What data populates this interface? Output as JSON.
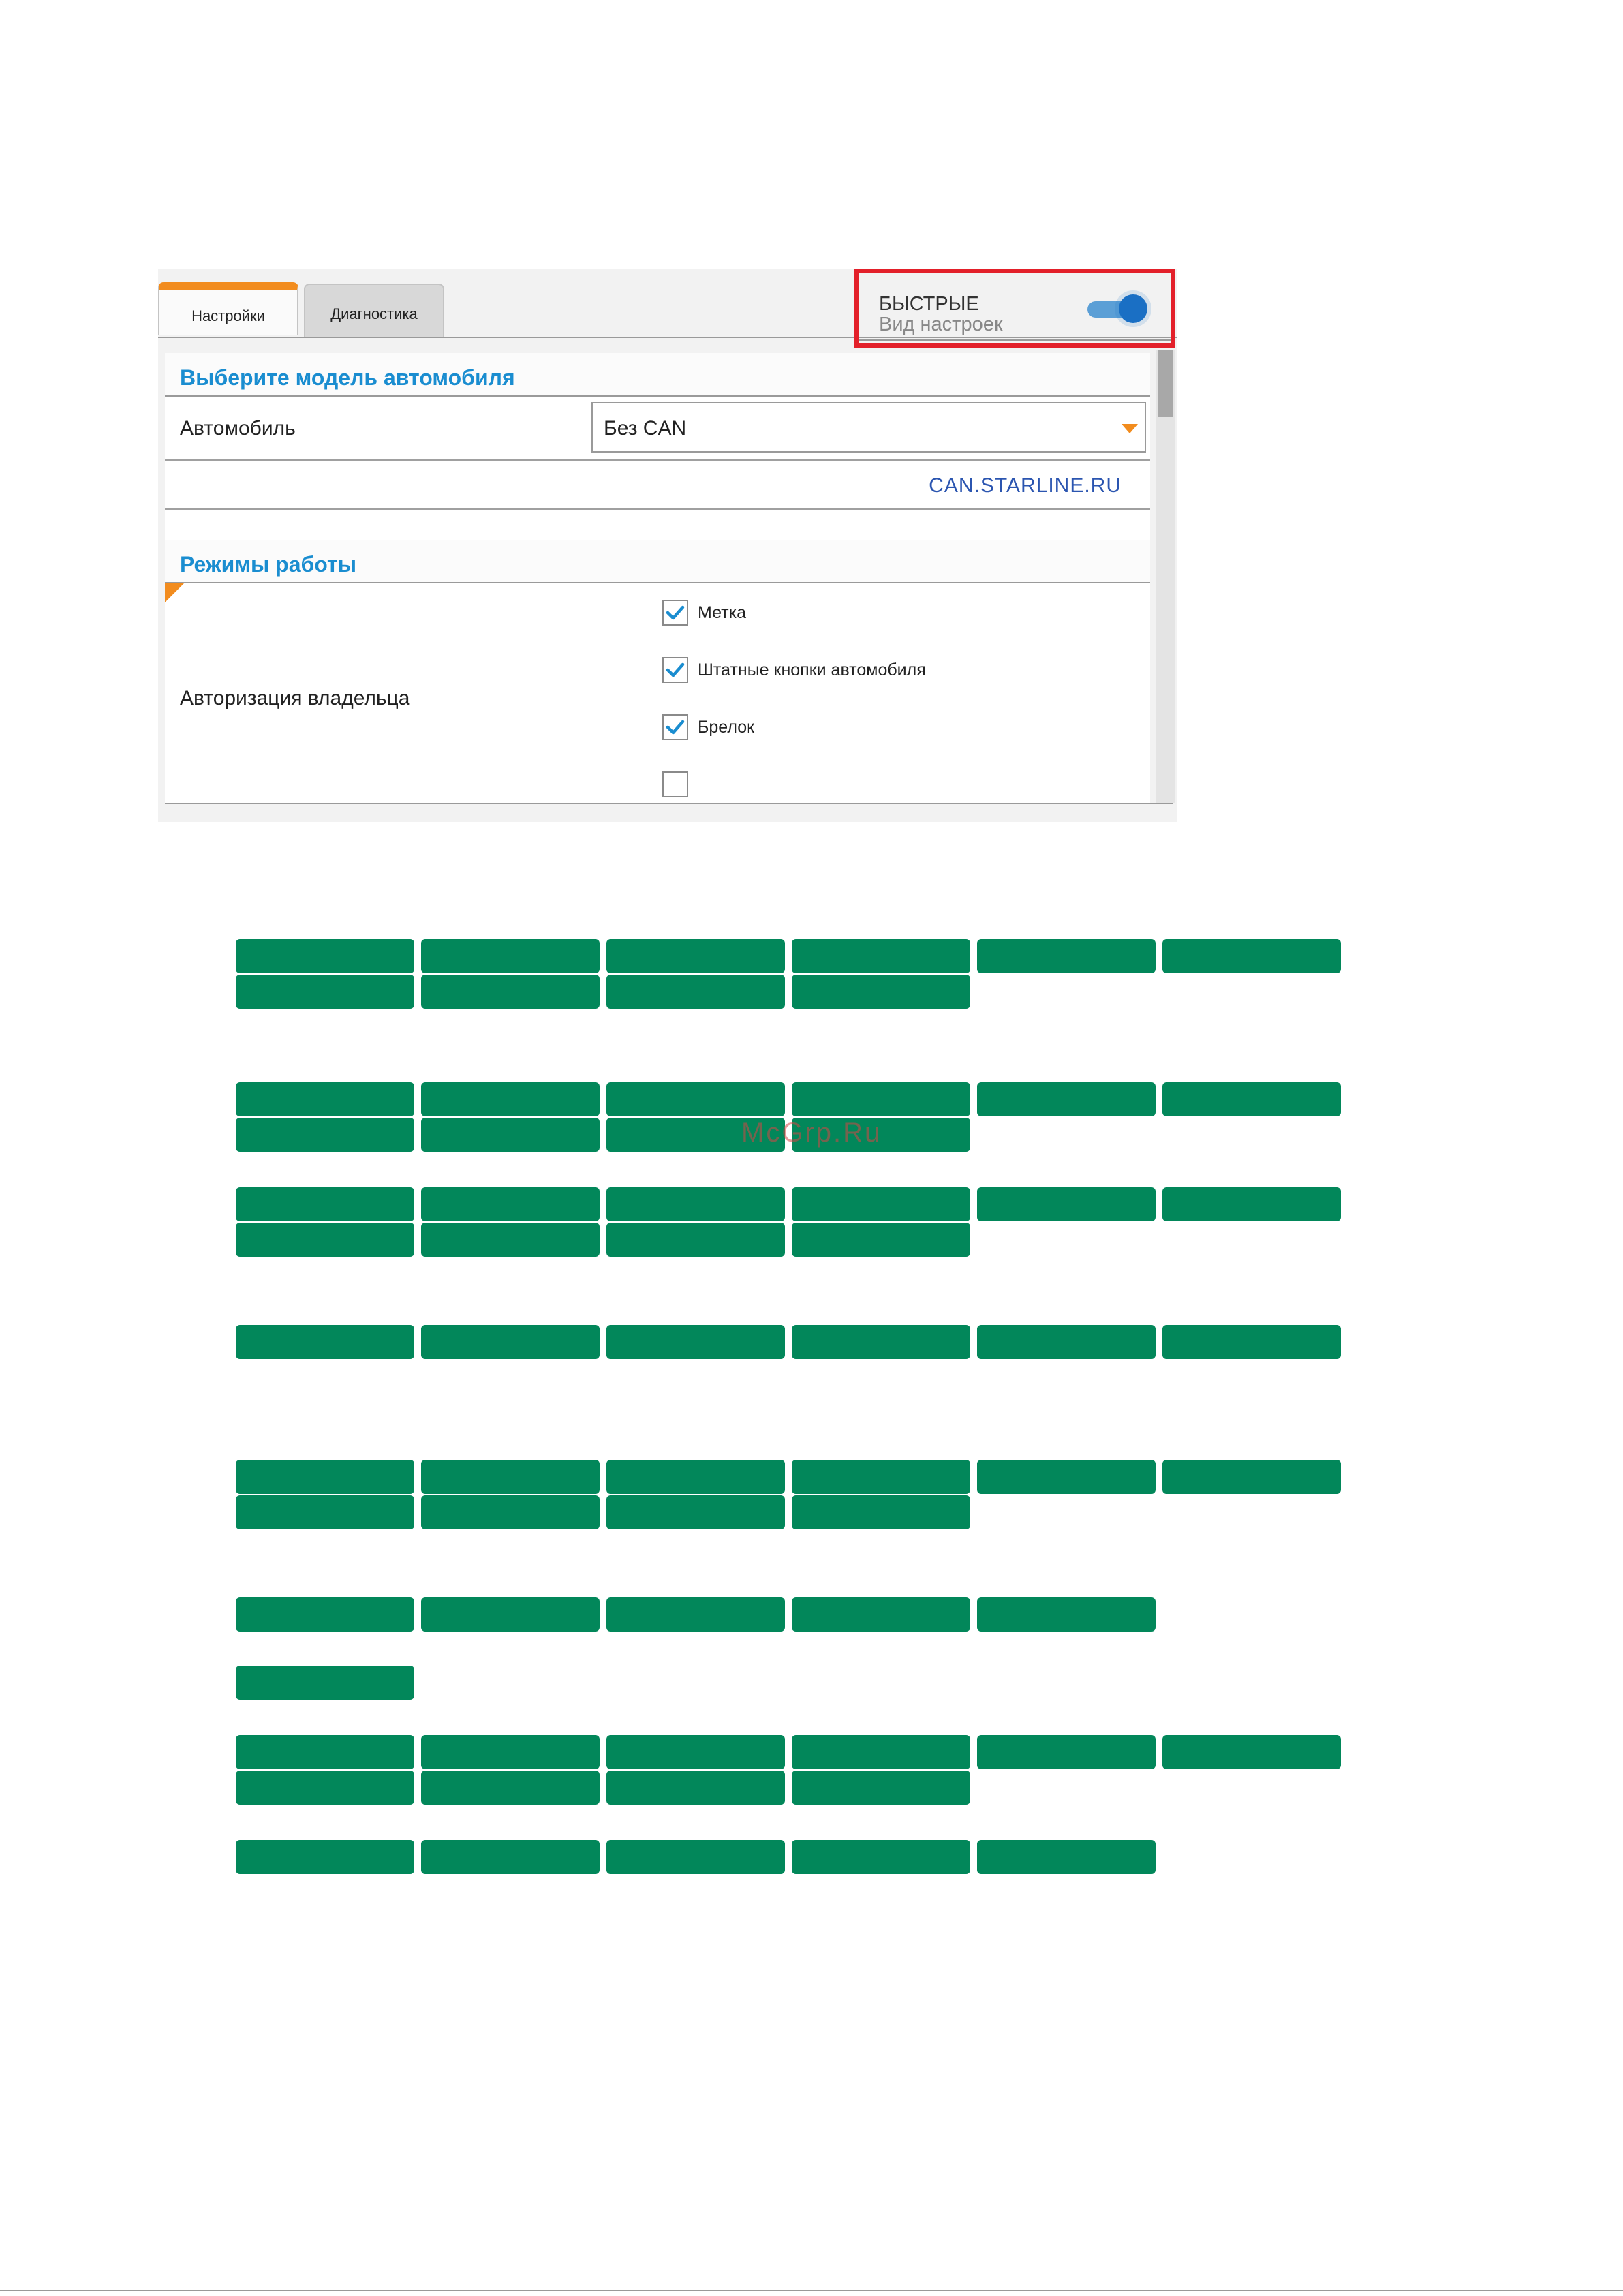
{
  "tabs": [
    {
      "label": "Настройки",
      "active": true
    },
    {
      "label": "Диагностика",
      "active": false
    }
  ],
  "settings_view": {
    "title": "БЫСТРЫЕ",
    "subtitle": "Вид настроек",
    "toggle_on": true
  },
  "car_section": {
    "heading": "Выберите модель автомобиля",
    "car_label": "Автомобиль",
    "car_value": "Без CAN",
    "link": "CAN.STARLINE.RU"
  },
  "modes_section": {
    "heading": "Режимы работы",
    "auth_label": "Авторизация владельца",
    "options": [
      {
        "label": "Метка",
        "checked": true
      },
      {
        "label": "Штатные кнопки автомобиля",
        "checked": true
      },
      {
        "label": "Брелок",
        "checked": true
      }
    ]
  },
  "watermark": "McGrp.Ru",
  "colors": {
    "accent_orange": "#f28c1e",
    "heading_blue": "#1a8dd0",
    "highlight_red": "#e3202a",
    "redaction_green": "#02875a"
  }
}
